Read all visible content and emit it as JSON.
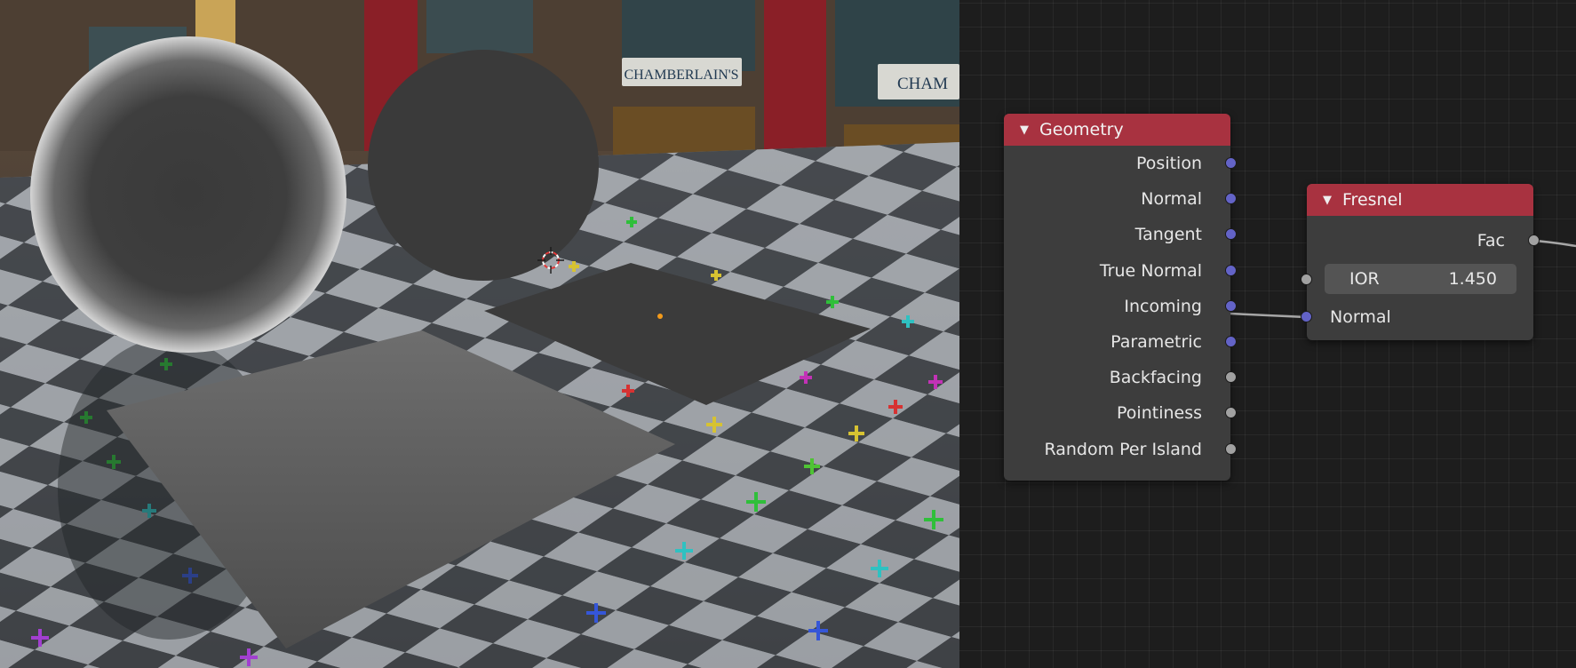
{
  "viewport": {
    "storefront_sign_1": "CHAMBERLAIN'S",
    "storefront_sign_2": "CHAM"
  },
  "geometry_node": {
    "title": "Geometry",
    "outputs": [
      {
        "label": "Position",
        "type": "vector"
      },
      {
        "label": "Normal",
        "type": "vector"
      },
      {
        "label": "Tangent",
        "type": "vector"
      },
      {
        "label": "True Normal",
        "type": "vector"
      },
      {
        "label": "Incoming",
        "type": "vector"
      },
      {
        "label": "Parametric",
        "type": "vector"
      },
      {
        "label": "Backfacing",
        "type": "float"
      },
      {
        "label": "Pointiness",
        "type": "float"
      },
      {
        "label": "Random Per Island",
        "type": "float"
      }
    ]
  },
  "fresnel_node": {
    "title": "Fresnel",
    "output_label": "Fac",
    "ior_label": "IOR",
    "ior_value": "1.450",
    "normal_label": "Normal"
  },
  "colors": {
    "node_header": "#a83240",
    "node_body": "#3d3d3d",
    "vector_socket": "#6363c7",
    "float_socket": "#a1a1a1",
    "editor_background": "#1d1d1d"
  },
  "icons": {
    "collapse": "triangle-down-icon",
    "cursor": "3d-cursor-icon"
  }
}
